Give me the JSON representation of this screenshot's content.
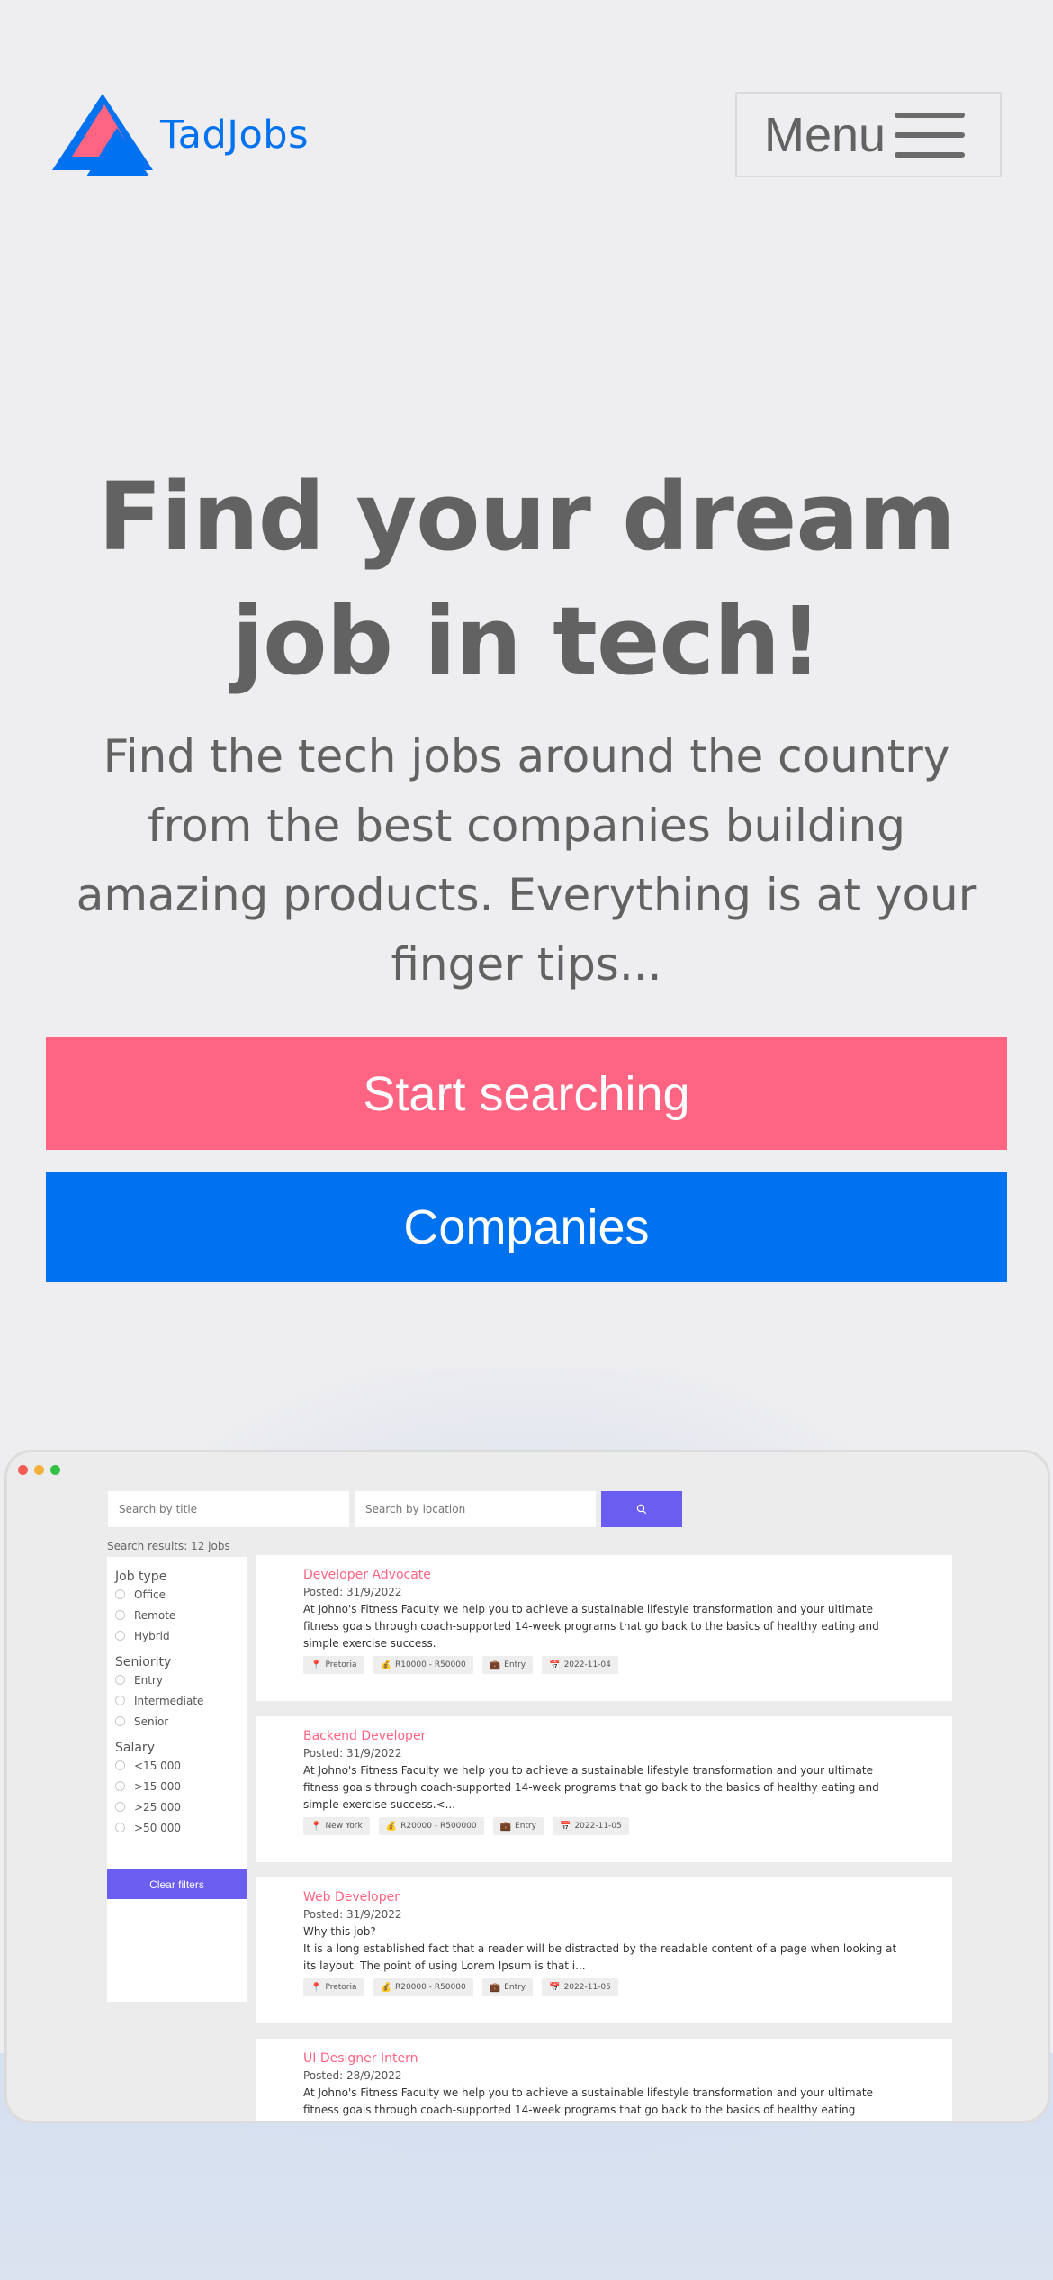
{
  "header": {
    "brand": "TadJobs",
    "menu_label": "Menu",
    "colors": {
      "brand_blue": "#0072f0",
      "brand_pink": "#ff6482"
    }
  },
  "hero": {
    "title": "Find your dream job in tech!",
    "subtitle": "Find the tech jobs around the country from the best companies building amazing products. Everything is at your finger tips...",
    "primary_button": "Start searching",
    "secondary_button": "Companies"
  },
  "preview": {
    "search_title_placeholder": "Search by title",
    "search_location_placeholder": "Search by location",
    "search_icon": "search-icon",
    "results_label": "Search results: 12 jobs",
    "filters": {
      "job_type": {
        "heading": "Job type",
        "options": [
          "Office",
          "Remote",
          "Hybrid"
        ]
      },
      "seniority": {
        "heading": "Seniority",
        "options": [
          "Entry",
          "Intermediate",
          "Senior"
        ]
      },
      "salary": {
        "heading": "Salary",
        "options": [
          "<15 000",
          ">15 000",
          ">25 000",
          ">50 000"
        ]
      },
      "clear_label": "Clear filters"
    },
    "jobs": [
      {
        "title": "Developer Advocate",
        "posted": "Posted: 31/9/2022",
        "description": "At Johno's Fitness Faculty we help you to achieve a sustainable lifestyle transformation and your ultimate fitness goals through coach-supported 14-week programs that go back to the basics of healthy eating and simple exercise success.",
        "location": "Pretoria",
        "salary": "R10000 - R50000",
        "level": "Entry",
        "date": "2022-11-04"
      },
      {
        "title": "Backend Developer",
        "posted": "Posted: 31/9/2022",
        "description": "At Johno's Fitness Faculty we help you to achieve a sustainable lifestyle transformation and your ultimate fitness goals through coach-supported 14-week programs that go back to the basics of healthy eating and simple exercise success.<...",
        "location": "New York",
        "salary": "R20000 - R500000",
        "level": "Entry",
        "date": "2022-11-05"
      },
      {
        "title": "Web Developer",
        "posted": "Posted: 31/9/2022",
        "description": "Why this job?",
        "description2": "It is a long established fact that a reader will be distracted by the readable content of a page when looking at its layout. The point of using Lorem Ipsum is that i...",
        "location": "Pretoria",
        "salary": "R20000 - R50000",
        "level": "Entry",
        "date": "2022-11-05"
      },
      {
        "title": "UI Designer Intern",
        "posted": "Posted: 28/9/2022",
        "description": "At Johno's Fitness Faculty we help you to achieve a sustainable lifestyle transformation and your ultimate fitness goals through coach-supported 14-week programs that go back to the basics of healthy eating"
      }
    ]
  }
}
